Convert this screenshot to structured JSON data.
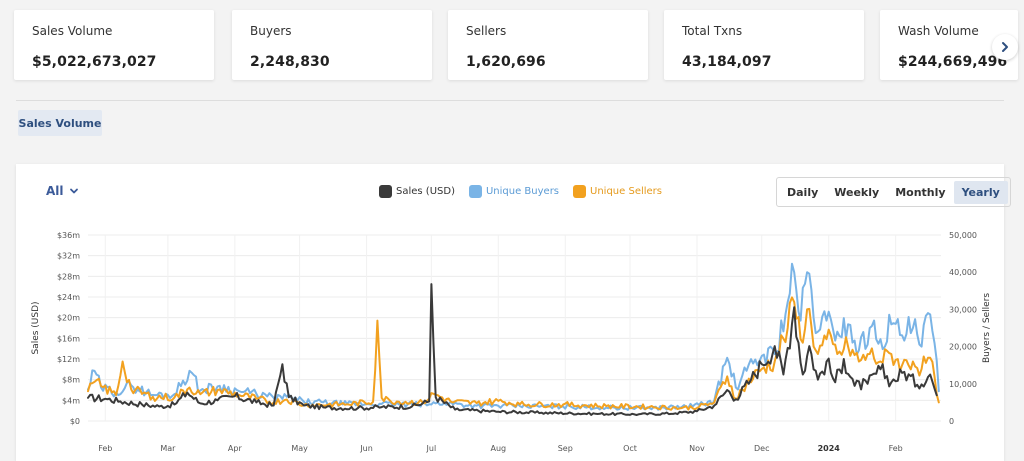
{
  "stats": [
    {
      "label": "Sales Volume",
      "value": "$5,022,673,027"
    },
    {
      "label": "Buyers",
      "value": "2,248,830"
    },
    {
      "label": "Sellers",
      "value": "1,620,696"
    },
    {
      "label": "Total Txns",
      "value": "43,184,097"
    },
    {
      "label": "Wash Volume",
      "value": "$244,669,496"
    }
  ],
  "tab": {
    "label": "Sales Volume"
  },
  "filter": {
    "label": "All"
  },
  "periods": {
    "daily": "Daily",
    "weekly": "Weekly",
    "monthly": "Monthly",
    "yearly": "Yearly",
    "active": "Yearly"
  },
  "colors": {
    "sales": "#3a3a3a",
    "buyers": "#7ab4e6",
    "sellers": "#f2a11f",
    "accent": "#3b5a99"
  },
  "chart_data": {
    "type": "line",
    "legend_position": "top-center",
    "grid": true,
    "ylabel_left": "Sales (USD)",
    "ylabel_right": "Buyers / Sellers",
    "y_left_ticks": [
      "$0",
      "$4m",
      "$8m",
      "$12m",
      "$16m",
      "$20m",
      "$24m",
      "$28m",
      "$32m",
      "$36m"
    ],
    "y_left_range": [
      0,
      36
    ],
    "y_right_ticks": [
      "0",
      "10,000",
      "20,000",
      "30,000",
      "40,000",
      "50,000"
    ],
    "y_right_range": [
      0,
      50000
    ],
    "x_ticks": [
      "Feb",
      "Mar",
      "Apr",
      "May",
      "Jun",
      "Jul",
      "Aug",
      "Sep",
      "Oct",
      "Nov",
      "Dec",
      "2024",
      "Feb"
    ],
    "x_tick_days": [
      8,
      37,
      68,
      98,
      129,
      159,
      190,
      221,
      251,
      282,
      312,
      343,
      374
    ],
    "x_range_days": [
      0,
      395
    ],
    "series": [
      {
        "name": "Sales (USD)",
        "axis": "left",
        "anchors": [
          [
            0,
            4.5
          ],
          [
            8,
            4.3
          ],
          [
            15,
            3.8
          ],
          [
            25,
            3.2
          ],
          [
            33,
            2.8
          ],
          [
            40,
            3.2
          ],
          [
            46,
            5.5
          ],
          [
            52,
            3.4
          ],
          [
            60,
            4.0
          ],
          [
            68,
            4.8
          ],
          [
            78,
            3.6
          ],
          [
            86,
            3.0
          ],
          [
            90,
            11.0
          ],
          [
            93,
            4.6
          ],
          [
            100,
            3.0
          ],
          [
            110,
            2.6
          ],
          [
            125,
            2.5
          ],
          [
            136,
            2.7
          ],
          [
            150,
            2.8
          ],
          [
            158,
            3.8
          ],
          [
            159,
            26.5
          ],
          [
            161,
            4.6
          ],
          [
            170,
            2.2
          ],
          [
            190,
            1.8
          ],
          [
            210,
            1.6
          ],
          [
            235,
            1.4
          ],
          [
            255,
            1.3
          ],
          [
            272,
            1.5
          ],
          [
            282,
            1.9
          ],
          [
            290,
            3.0
          ],
          [
            296,
            6.0
          ],
          [
            300,
            4.2
          ],
          [
            307,
            8.0
          ],
          [
            312,
            11.0
          ],
          [
            318,
            14.5
          ],
          [
            322,
            9.0
          ],
          [
            327,
            22.0
          ],
          [
            331,
            9.0
          ],
          [
            334,
            14.5
          ],
          [
            338,
            8.0
          ],
          [
            342,
            11.5
          ],
          [
            346,
            7.5
          ],
          [
            350,
            12.0
          ],
          [
            355,
            6.8
          ],
          [
            361,
            7.2
          ],
          [
            367,
            10.0
          ],
          [
            372,
            7.5
          ],
          [
            378,
            9.5
          ],
          [
            384,
            7.0
          ],
          [
            390,
            9.0
          ],
          [
            393,
            5.0
          ]
        ]
      },
      {
        "name": "Unique Buyers",
        "axis": "right",
        "anchors": [
          [
            0,
            8500
          ],
          [
            3,
            13500
          ],
          [
            6,
            9000
          ],
          [
            13,
            7700
          ],
          [
            20,
            9600
          ],
          [
            30,
            7000
          ],
          [
            40,
            7200
          ],
          [
            47,
            13500
          ],
          [
            52,
            8200
          ],
          [
            60,
            9300
          ],
          [
            70,
            8000
          ],
          [
            78,
            7300
          ],
          [
            86,
            6200
          ],
          [
            92,
            6500
          ],
          [
            100,
            5200
          ],
          [
            120,
            4600
          ],
          [
            136,
            4600
          ],
          [
            148,
            4400
          ],
          [
            158,
            4500
          ],
          [
            165,
            4900
          ],
          [
            180,
            4100
          ],
          [
            200,
            4000
          ],
          [
            220,
            3900
          ],
          [
            240,
            3600
          ],
          [
            260,
            3500
          ],
          [
            275,
            3800
          ],
          [
            283,
            4300
          ],
          [
            290,
            5500
          ],
          [
            296,
            17000
          ],
          [
            300,
            9000
          ],
          [
            305,
            13500
          ],
          [
            312,
            17500
          ],
          [
            318,
            18000
          ],
          [
            324,
            32000
          ],
          [
            327,
            40000
          ],
          [
            330,
            27000
          ],
          [
            333,
            40000
          ],
          [
            338,
            24000
          ],
          [
            342,
            27000
          ],
          [
            347,
            24000
          ],
          [
            352,
            26000
          ],
          [
            357,
            19000
          ],
          [
            362,
            25000
          ],
          [
            367,
            22000
          ],
          [
            372,
            26000
          ],
          [
            377,
            23000
          ],
          [
            382,
            25000
          ],
          [
            386,
            20000
          ],
          [
            389,
            29000
          ],
          [
            392,
            21000
          ],
          [
            394,
            8000
          ]
        ]
      },
      {
        "name": "Unique Sellers",
        "axis": "right",
        "anchors": [
          [
            0,
            8000
          ],
          [
            3,
            10500
          ],
          [
            6,
            9400
          ],
          [
            13,
            7000
          ],
          [
            16,
            16000
          ],
          [
            20,
            8500
          ],
          [
            30,
            6500
          ],
          [
            40,
            6300
          ],
          [
            47,
            9000
          ],
          [
            52,
            7200
          ],
          [
            60,
            8300
          ],
          [
            70,
            7000
          ],
          [
            78,
            6000
          ],
          [
            86,
            5000
          ],
          [
            92,
            5800
          ],
          [
            100,
            4300
          ],
          [
            120,
            4500
          ],
          [
            132,
            5200
          ],
          [
            134,
            27000
          ],
          [
            136,
            6200
          ],
          [
            140,
            5400
          ],
          [
            155,
            4900
          ],
          [
            160,
            7300
          ],
          [
            168,
            5200
          ],
          [
            180,
            4800
          ],
          [
            190,
            5400
          ],
          [
            200,
            4500
          ],
          [
            220,
            4400
          ],
          [
            240,
            4000
          ],
          [
            260,
            3800
          ],
          [
            275,
            3500
          ],
          [
            283,
            3800
          ],
          [
            290,
            5000
          ],
          [
            296,
            12000
          ],
          [
            300,
            6000
          ],
          [
            305,
            10000
          ],
          [
            312,
            14000
          ],
          [
            318,
            16000
          ],
          [
            324,
            25000
          ],
          [
            327,
            32000
          ],
          [
            330,
            22000
          ],
          [
            333,
            30000
          ],
          [
            338,
            18000
          ],
          [
            342,
            22000
          ],
          [
            347,
            18000
          ],
          [
            352,
            20000
          ],
          [
            357,
            16000
          ],
          [
            362,
            18000
          ],
          [
            367,
            16000
          ],
          [
            372,
            18000
          ],
          [
            377,
            15000
          ],
          [
            382,
            16000
          ],
          [
            386,
            14000
          ],
          [
            389,
            17000
          ],
          [
            392,
            12000
          ],
          [
            394,
            5000
          ]
        ]
      }
    ]
  }
}
